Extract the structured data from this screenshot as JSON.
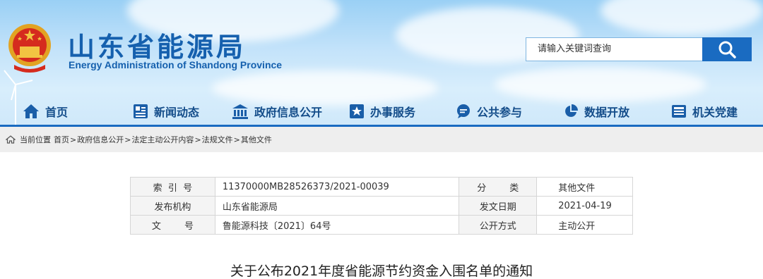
{
  "site": {
    "title_cn": "山东省能源局",
    "title_en": "Energy Administration of Shandong Province"
  },
  "search": {
    "placeholder": "请输入关键词查询"
  },
  "nav": {
    "items": [
      {
        "label": "首页",
        "icon": "home-icon"
      },
      {
        "label": "新闻动态",
        "icon": "newspaper-icon"
      },
      {
        "label": "政府信息公开",
        "icon": "government-building-icon"
      },
      {
        "label": "办事服务",
        "icon": "service-star-icon"
      },
      {
        "label": "公共参与",
        "icon": "chat-bubble-icon"
      },
      {
        "label": "数据开放",
        "icon": "pie-chart-icon"
      },
      {
        "label": "机关党建",
        "icon": "party-building-icon"
      }
    ]
  },
  "breadcrumb": {
    "prefix": "当前位置",
    "items": [
      "首页",
      "政府信息公开",
      "法定主动公开内容",
      "法规文件",
      "其他文件"
    ],
    "separator": ">"
  },
  "info": {
    "rows": [
      {
        "k1": "索  引  号",
        "v1": "11370000MB28526373/2021-00039",
        "k2": "分        类",
        "v2": "其他文件"
      },
      {
        "k1": "发布机构",
        "v1": "山东省能源局",
        "k2": "发文日期",
        "v2": "2021-04-19"
      },
      {
        "k1": "文        号",
        "v1": "鲁能源科技〔2021〕64号",
        "k2": "公开方式",
        "v2": "主动公开"
      }
    ]
  },
  "document": {
    "title": "关于公布2021年度省能源节约资金入围名单的通知"
  },
  "colors": {
    "brand_blue": "#1560ae",
    "nav_text": "#144d8a",
    "search_button": "#1a6bc1",
    "breadcrumb_bg": "#eeeeee"
  }
}
